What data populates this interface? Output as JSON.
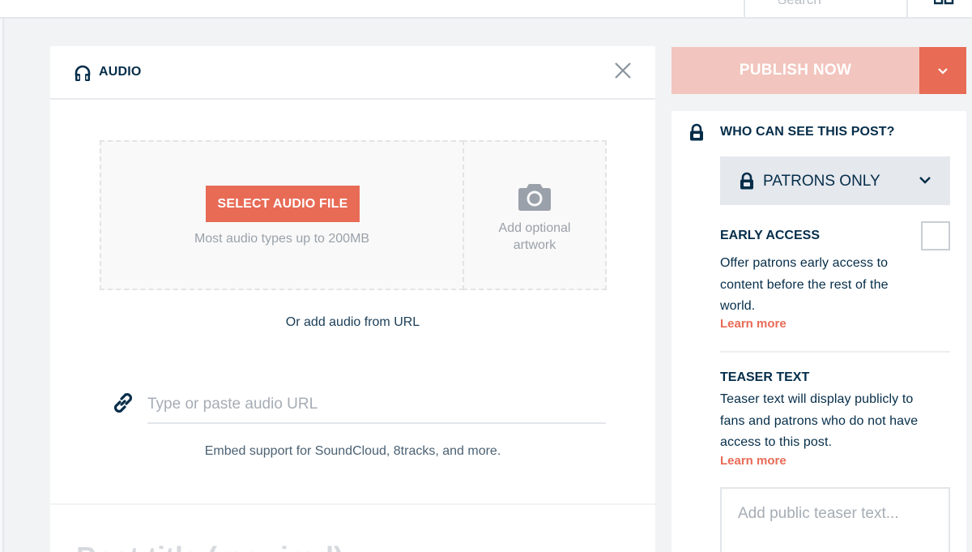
{
  "topbar": {
    "search_label": "Search",
    "search_icon": "search-icon",
    "grid_icon": "grid-icon"
  },
  "audio_card": {
    "header_icon": "headphones-icon",
    "title": "AUDIO",
    "close_icon": "close-icon",
    "select_button": "SELECT AUDIO FILE",
    "file_hint": "Most audio types up to 200MB",
    "artwork_icon": "camera-icon",
    "artwork_label_line1": "Add optional",
    "artwork_label_line2": "artwork",
    "or_url": "Or add audio from URL",
    "link_icon": "link-icon",
    "url_placeholder": "Type or paste audio URL",
    "url_value": "",
    "embed_note": "Embed support for SoundCloud, 8tracks, and more."
  },
  "post_title": {
    "placeholder": "Post title (required)"
  },
  "publish": {
    "label": "PUBLISH NOW",
    "dropdown_icon": "chevron-down-icon"
  },
  "visibility": {
    "heading_icon": "lock-icon",
    "heading": "WHO CAN SEE THIS POST?",
    "selected": "PATRONS ONLY",
    "select_icon": "lock-icon",
    "select_chevron": "chevron-down-icon"
  },
  "early_access": {
    "heading": "EARLY ACCESS",
    "checked": false,
    "description": "Offer patrons early access to content before the rest of the world.",
    "learn_more": "Learn more"
  },
  "teaser": {
    "heading": "TEASER TEXT",
    "description": "Teaser text will display publicly to fans and patrons who do not have access to this post.",
    "learn_more": "Learn more",
    "placeholder": "Add public teaser text..."
  },
  "colors": {
    "accent": "#e86b56",
    "accent_disabled": "#f2c5be",
    "text_dark": "#052d49",
    "background": "#f2f3f5"
  }
}
